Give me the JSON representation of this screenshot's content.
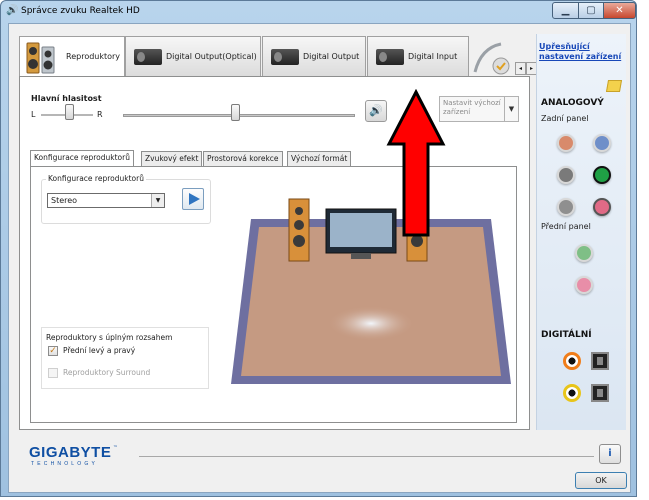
{
  "window": {
    "title": "Správce zvuku Realtek HD"
  },
  "device_tabs": [
    {
      "label": "Reproduktory",
      "active": true
    },
    {
      "label": "Digital Output(Optical)"
    },
    {
      "label": "Digital Output"
    },
    {
      "label": "Digital Input"
    }
  ],
  "volume": {
    "title": "Hlavní hlasitost",
    "left_label": "L",
    "right_label": "R",
    "balance": 0.5,
    "level": 0.5,
    "default_device": "Nastavit výchozí zařízení"
  },
  "sub_tabs": [
    "Konfigurace reproduktorů",
    "Zvukový efekt",
    "Prostorová korekce",
    "Výchozí formát"
  ],
  "speaker_config": {
    "group_label": "Konfigurace reproduktorů",
    "selected": "Stereo"
  },
  "full_range": {
    "title": "Reproduktory s úplným rozsahem",
    "front": {
      "label": "Přední levý a pravý",
      "checked": true
    },
    "surround": {
      "label": "Reproduktory Surround",
      "checked": false,
      "disabled": true
    }
  },
  "right_panel": {
    "advanced_link": "Upřesňující nastavení zařízení",
    "analog_title": "ANALOGOVÝ",
    "rear_panel": "Zadní panel",
    "front_panel": "Přední panel",
    "digital_title": "DIGITÁLNÍ",
    "colors": {
      "rear": [
        "#d88a6b",
        "#6f8fc9",
        "#7a7a7a",
        "#1fa045",
        "#8f8f8f",
        "#e06a86"
      ],
      "front": [
        "#7fbf86",
        "#e88ea8"
      ]
    }
  },
  "footer": {
    "logo": "GIGABYTE",
    "logo_tm": "™",
    "logo_sub": "TECHNOLOGY",
    "ok_label": "OK"
  }
}
